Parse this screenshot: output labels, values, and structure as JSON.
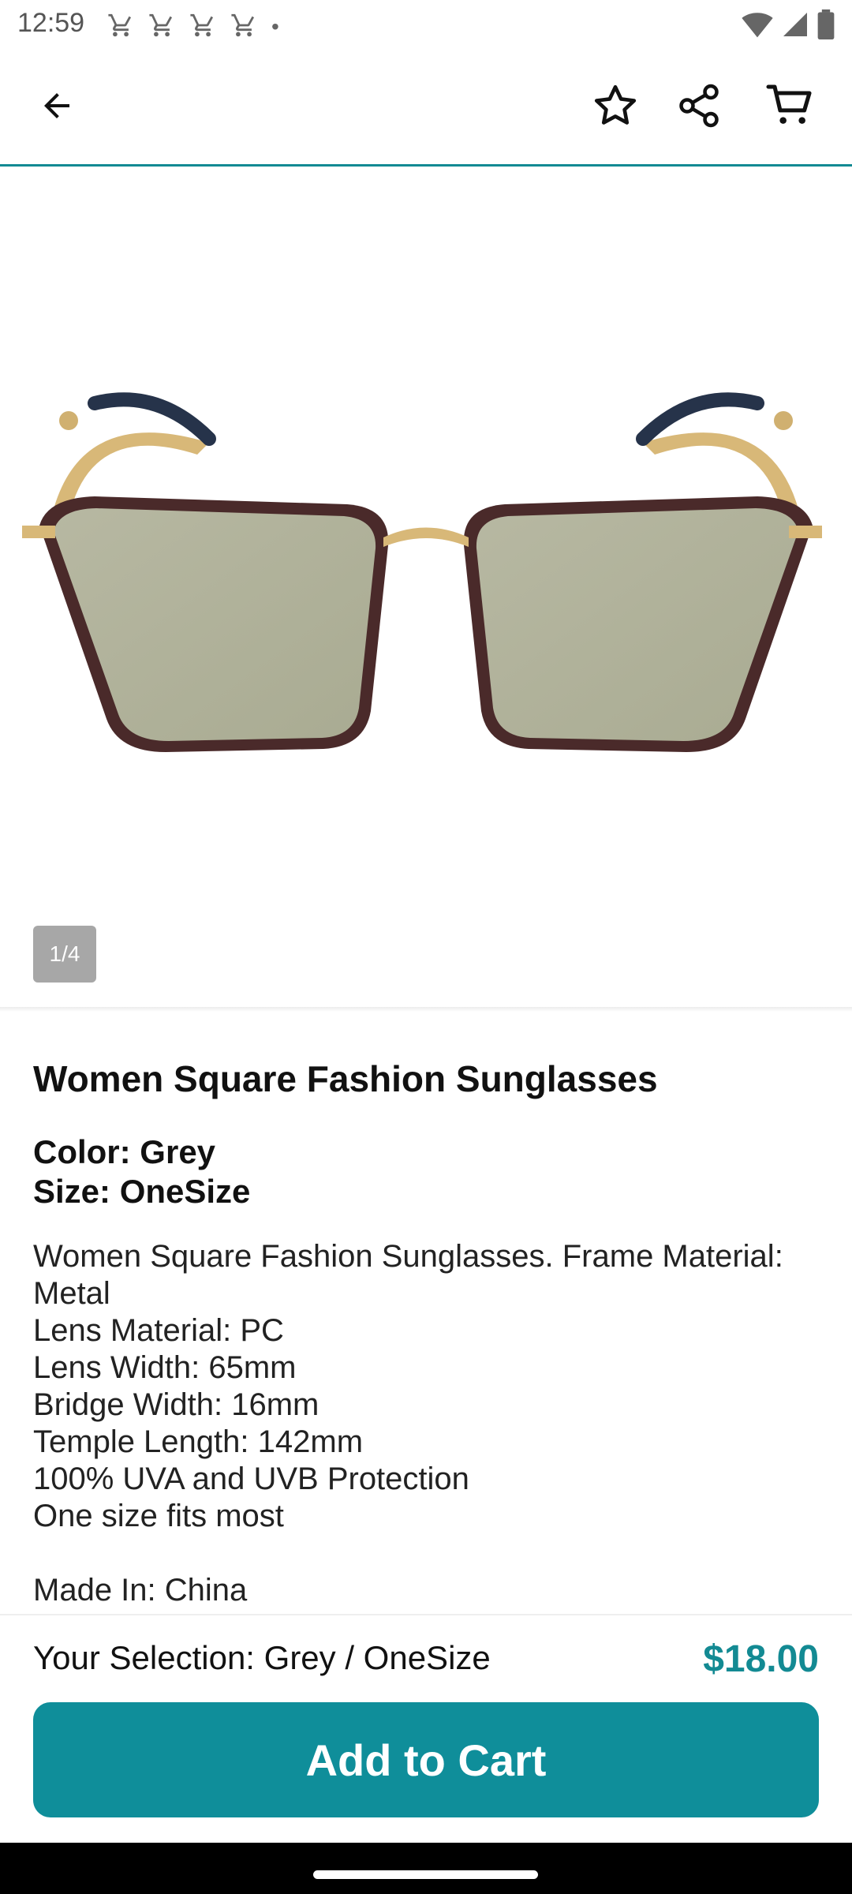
{
  "status_bar": {
    "time": "12:59",
    "notification_icons": [
      "cart-icon",
      "cart-icon",
      "cart-icon",
      "cart-icon"
    ],
    "dot": "•",
    "right_icons": [
      "wifi-icon",
      "signal-icon",
      "battery-icon"
    ]
  },
  "toolbar": {
    "back_icon": "arrow-left-icon",
    "favorite_icon": "star-icon",
    "share_icon": "share-icon",
    "cart_icon": "cart-icon"
  },
  "gallery": {
    "indicator": "1/4"
  },
  "product": {
    "title": "Women Square Fashion Sunglasses",
    "color_label": "Color: Grey",
    "size_label": "Size: OneSize",
    "description": "Women Square Fashion Sunglasses. Frame Material: Metal\nLens Material: PC\nLens Width: 65mm\nBridge Width: 16mm\nTemple Length: 142mm\n100% UVA and UVB Protection\nOne size fits most\n\nMade In: China"
  },
  "bottom": {
    "selection": "Your Selection: Grey / OneSize",
    "price": "$18.00",
    "add_to_cart": "Add to Cart"
  },
  "colors": {
    "accent": "#0f8e9a",
    "price": "#138a93",
    "indicator_bg": "#a7a7a7"
  }
}
